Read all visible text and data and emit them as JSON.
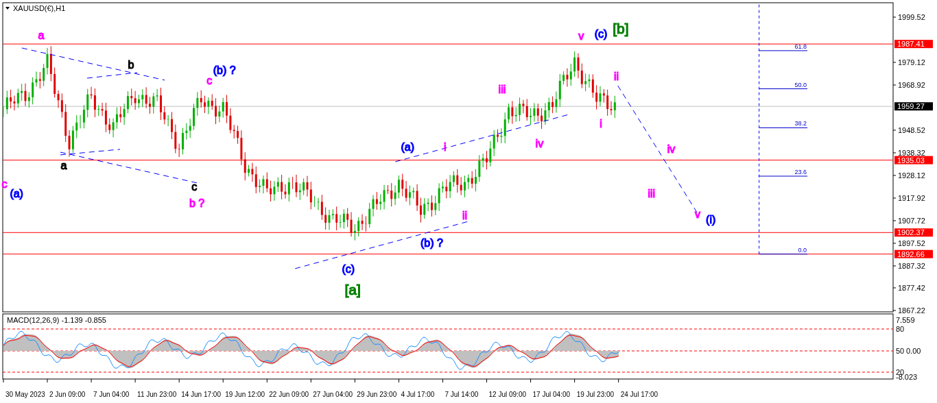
{
  "price_chart": {
    "title": "XAUUSD(€),H1",
    "price_axis": [
      "1999.52",
      "1979.12",
      "1968.92",
      "1948.52",
      "1938.32",
      "1928.12",
      "1917.92",
      "1907.72",
      "1897.52",
      "1887.32",
      "1877.42",
      "1867.22"
    ],
    "time_axis": [
      "30 May 2023",
      "2 Jun 09:00",
      "7 Jun 04:00",
      "11 Jun 23:00",
      "14 Jun 17:00",
      "19 Jun 12:00",
      "22 Jun 09:00",
      "27 Jun 04:00",
      "29 Jun 23:00",
      "4 Jul 17:00",
      "7 Jul 14:00",
      "12 Jul 09:00",
      "17 Jul 04:00",
      "19 Jul 23:00",
      "24 Jul 17:00"
    ],
    "price_levels": [
      {
        "price": "1987.41"
      },
      {
        "price": "1935.03"
      },
      {
        "price": "1902.37"
      },
      {
        "price": "1892.66"
      }
    ],
    "current_price": "1959.27",
    "fibonacci_levels": [
      "61.8",
      "50.0",
      "38.2",
      "23.6",
      "0.0"
    ],
    "wave_labels": [
      {
        "label": "a",
        "color": "#ff00ff",
        "kind": "minor"
      },
      {
        "label": "b",
        "color": "#000000",
        "kind": "minor"
      },
      {
        "label": "a",
        "color": "#000000",
        "kind": "minor"
      },
      {
        "label": "c",
        "color": "#000000",
        "kind": "minor"
      },
      {
        "label": "(b) ?",
        "color": "#0000ff",
        "kind": "minor"
      },
      {
        "label": "c",
        "color": "#ff00ff",
        "kind": "minor"
      },
      {
        "label": "b ?",
        "color": "#ff00ff",
        "kind": "minor"
      },
      {
        "label": "c",
        "color": "#ff00ff",
        "kind": "minor"
      },
      {
        "label": "(a)",
        "color": "#0000ff",
        "kind": "minor"
      },
      {
        "label": "(c)",
        "color": "#0000ff",
        "kind": "minor"
      },
      {
        "label": "[a]",
        "color": "#008000",
        "kind": "major"
      },
      {
        "label": "(a)",
        "color": "#0000ff",
        "kind": "minor"
      },
      {
        "label": "i",
        "color": "#ff00ff",
        "kind": "minor"
      },
      {
        "label": "ii",
        "color": "#ff00ff",
        "kind": "minor"
      },
      {
        "label": "(b) ?",
        "color": "#0000ff",
        "kind": "minor"
      },
      {
        "label": "iii",
        "color": "#ff00ff",
        "kind": "minor"
      },
      {
        "label": "iv",
        "color": "#ff00ff",
        "kind": "minor"
      },
      {
        "label": "v",
        "color": "#ff00ff",
        "kind": "minor"
      },
      {
        "label": "(c)",
        "color": "#0000ff",
        "kind": "minor"
      },
      {
        "label": "[b]",
        "color": "#008000",
        "kind": "major"
      },
      {
        "label": "ii",
        "color": "#ff00ff",
        "kind": "minor"
      },
      {
        "label": "i",
        "color": "#ff00ff",
        "kind": "minor"
      },
      {
        "label": "iv",
        "color": "#ff00ff",
        "kind": "minor"
      },
      {
        "label": "iii",
        "color": "#ff00ff",
        "kind": "minor"
      },
      {
        "label": "v",
        "color": "#ff00ff",
        "kind": "minor"
      },
      {
        "label": "(i)",
        "color": "#0000ff",
        "kind": "minor"
      }
    ]
  },
  "macd": {
    "title": "MACD(12,26,9) -1.139 -0.855",
    "scale_labels": [
      "7.559",
      "80",
      "50",
      "0.00",
      "20",
      "-8.023"
    ]
  }
}
